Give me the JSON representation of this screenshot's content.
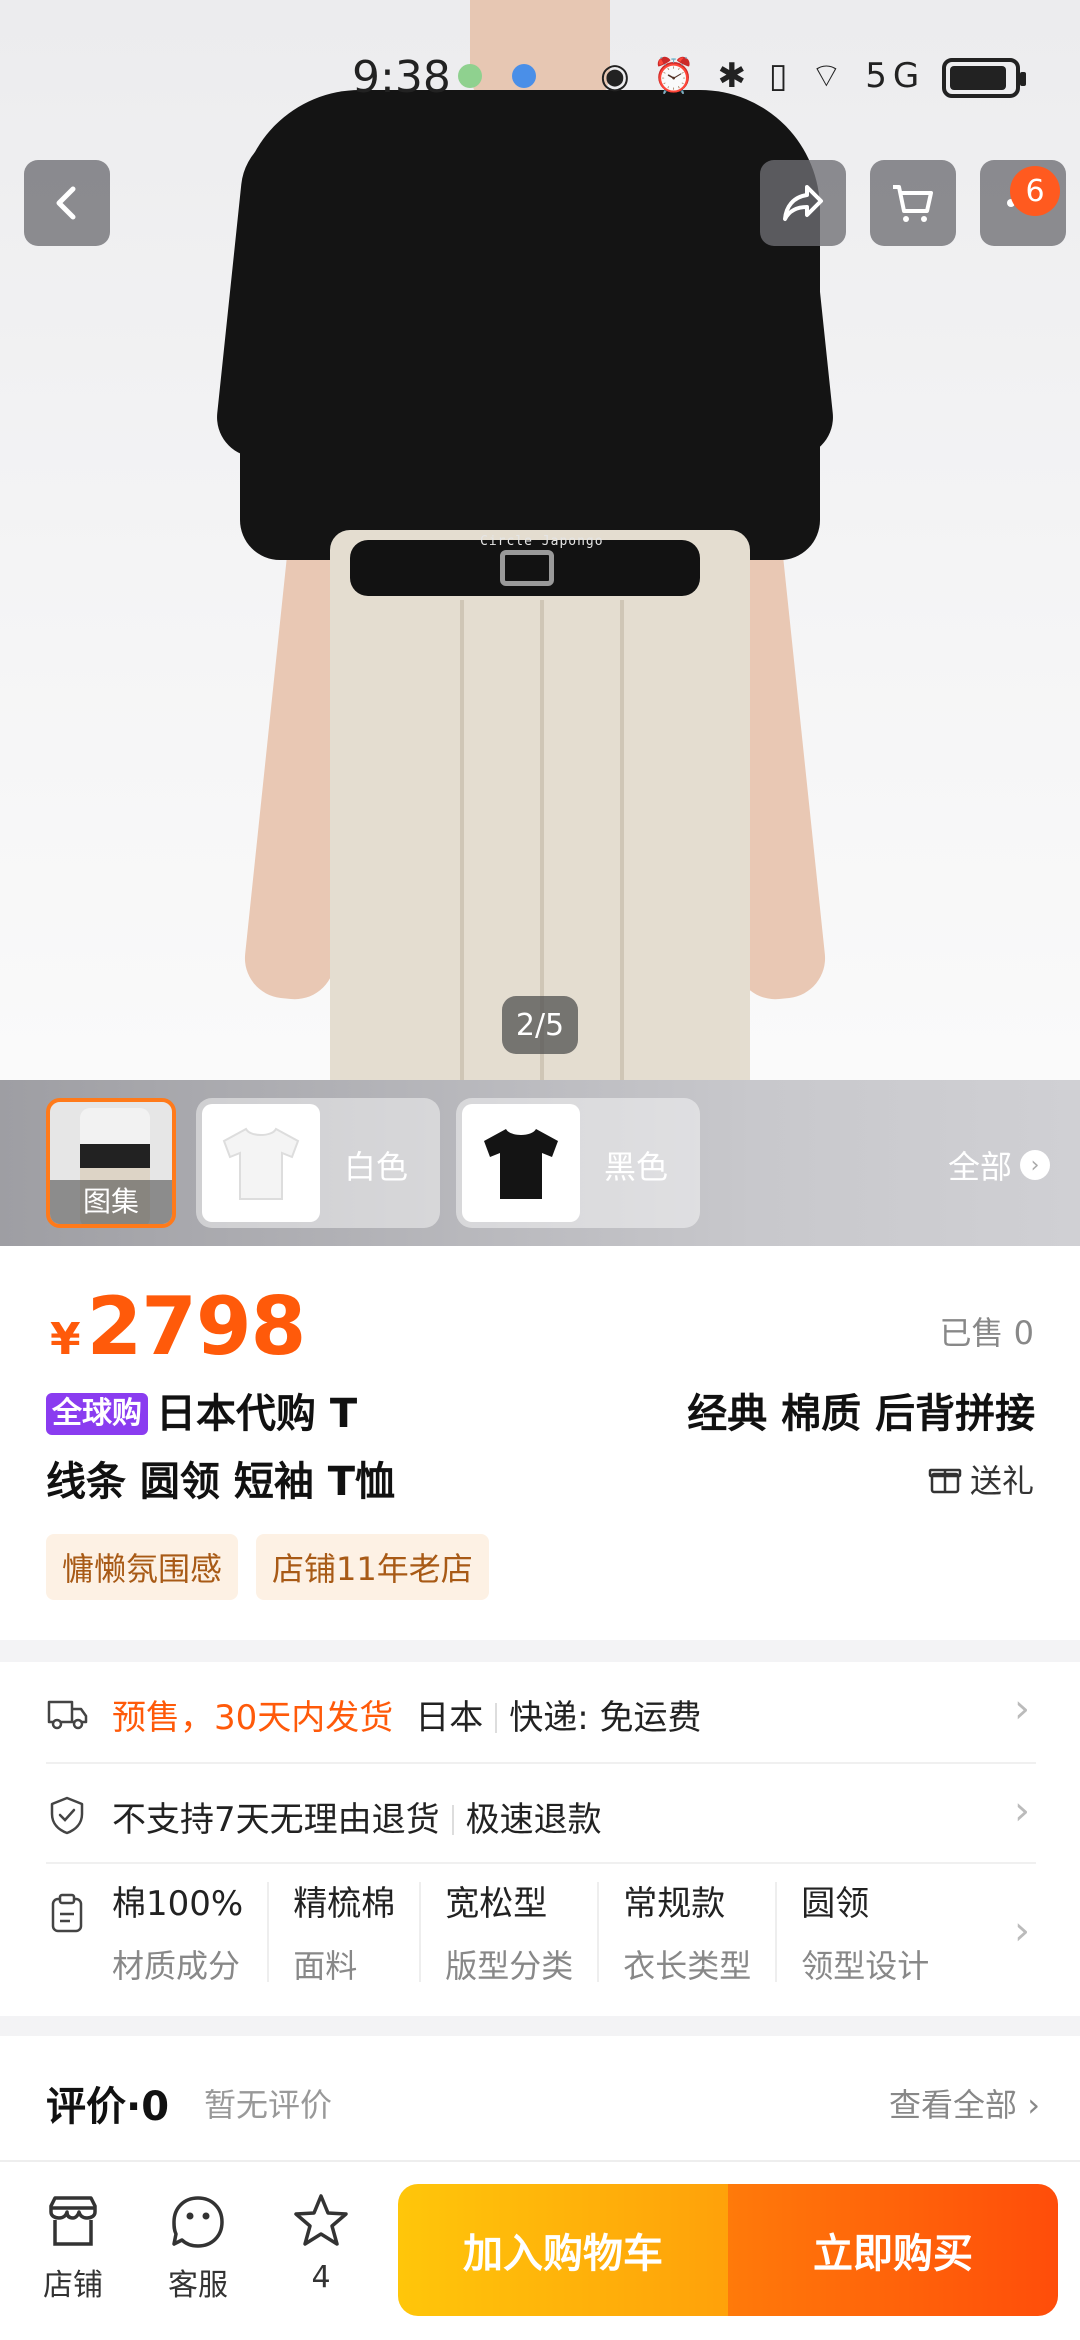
{
  "status_bar": {
    "time": "9:38",
    "icons_text": "◉ ⏰ ✱ ▯ ⌔ 5G",
    "battery_level": 0.9
  },
  "top_actions": {
    "cart_badge": "6"
  },
  "gallery": {
    "counter": "2/5",
    "watermark": "Circle Japongo"
  },
  "thumbnails": {
    "gallery_label": "图集",
    "variants": [
      {
        "name": "白色",
        "color": "#ffffff"
      },
      {
        "name": "黑色",
        "color": "#141414"
      }
    ],
    "all_label": "全部"
  },
  "product": {
    "currency": "¥",
    "price": "2798",
    "sold": "已售 0",
    "global_tag": "全球购",
    "title_part1": "日本代购 T",
    "title_part2": "经典 棉质 后背拼接线条 圆领 短袖 T恤",
    "gift_label": "送礼",
    "tags": [
      "慵懒氛围感",
      "店铺11年老店"
    ]
  },
  "service": {
    "shipping_highlight": "预售，30天内发货",
    "origin": "日本",
    "express": "快递: 免运费",
    "returns": "不支持7天无理由退货",
    "refund": "极速退款",
    "attributes": [
      {
        "value": "棉100%",
        "key": "材质成分"
      },
      {
        "value": "精梳棉",
        "key": "面料"
      },
      {
        "value": "宽松型",
        "key": "版型分类"
      },
      {
        "value": "常规款",
        "key": "衣长类型"
      },
      {
        "value": "圆领",
        "key": "领型设计"
      }
    ]
  },
  "reviews": {
    "title": "评价·0",
    "empty": "暂无评价",
    "view_all": "查看全部"
  },
  "bottom_bar": {
    "shop_label": "店铺",
    "service_label": "客服",
    "fav_count": "4",
    "add_cart_label": "加入购物车",
    "buy_label": "立即购买"
  },
  "colors": {
    "accent": "#ff5a0a",
    "cart_button": "#ffb40a",
    "global_tag": "#8a3cf0"
  }
}
